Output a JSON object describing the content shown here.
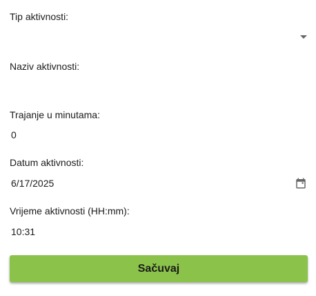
{
  "form": {
    "activity_type": {
      "label": "Tip aktivnosti:",
      "value": ""
    },
    "activity_name": {
      "label": "Naziv aktivnosti:",
      "value": ""
    },
    "duration": {
      "label": "Trajanje u minutama:",
      "value": "0"
    },
    "date": {
      "label": "Datum aktivnosti:",
      "value": "6/17/2025"
    },
    "time": {
      "label": "Vrijeme aktivnosti (HH:mm):",
      "value": "10:31"
    },
    "save_label": "Sačuvaj"
  },
  "icons": {
    "dropdown": "chevron-down-icon",
    "calendar": "calendar-icon"
  },
  "colors": {
    "accent": "#8bc34a",
    "icon": "#666666",
    "text": "#1a1a1a"
  }
}
